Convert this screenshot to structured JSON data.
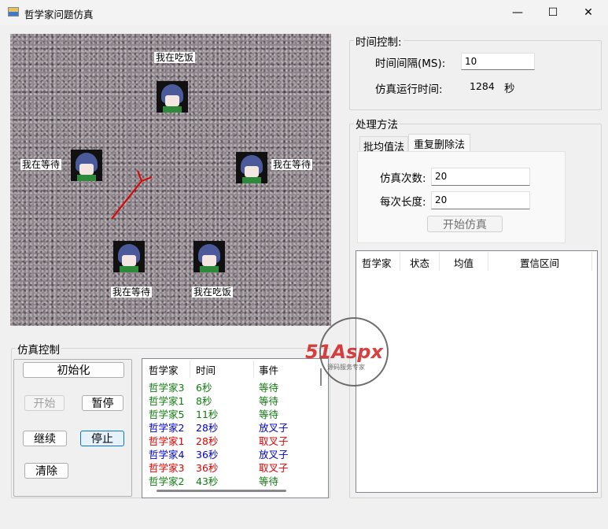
{
  "window": {
    "title": "哲学家问题仿真",
    "minimize": "—",
    "maximize": "☐",
    "close": "✕"
  },
  "canvas": {
    "labels": [
      "我在吃饭",
      "我在等待",
      "我在等待",
      "我在等待",
      "我在吃饭"
    ]
  },
  "sim_control": {
    "title": "仿真控制",
    "init": "初始化",
    "start": "开始",
    "pause": "暂停",
    "resume": "继续",
    "stop": "停止",
    "clear": "清除"
  },
  "log": {
    "headers": [
      "哲学家",
      "时间",
      "事件"
    ],
    "rows": [
      {
        "p": "哲学家3",
        "t": "6秒",
        "e": "等待",
        "color": "#107c10"
      },
      {
        "p": "哲学家1",
        "t": "8秒",
        "e": "等待",
        "color": "#107c10"
      },
      {
        "p": "哲学家5",
        "t": "11秒",
        "e": "等待",
        "color": "#107c10"
      },
      {
        "p": "哲学家2",
        "t": "28秒",
        "e": "放叉子",
        "color": "#0000c8"
      },
      {
        "p": "哲学家1",
        "t": "28秒",
        "e": "取叉子",
        "color": "#e00000"
      },
      {
        "p": "哲学家4",
        "t": "36秒",
        "e": "放叉子",
        "color": "#0000c8"
      },
      {
        "p": "哲学家3",
        "t": "36秒",
        "e": "取叉子",
        "color": "#e00000"
      },
      {
        "p": "哲学家2",
        "t": "43秒",
        "e": "等待",
        "color": "#107c10"
      }
    ]
  },
  "time_control": {
    "title": "时间控制:",
    "interval_label": "时间间隔(MS):",
    "interval_value": "10",
    "runtime_label": "仿真运行时间:",
    "runtime_value": "1284",
    "runtime_unit": "秒"
  },
  "method": {
    "title": "处理方法",
    "tabs": [
      "批均值法",
      "重复删除法"
    ],
    "runs_label": "仿真次数:",
    "runs_value": "20",
    "length_label": "每次长度:",
    "length_value": "20",
    "start": "开始仿真"
  },
  "results": {
    "headers": [
      "哲学家",
      "状态",
      "均值",
      "置信区间"
    ]
  },
  "watermark": {
    "brand": "51Aspx",
    "sub": "源码服务专家"
  }
}
